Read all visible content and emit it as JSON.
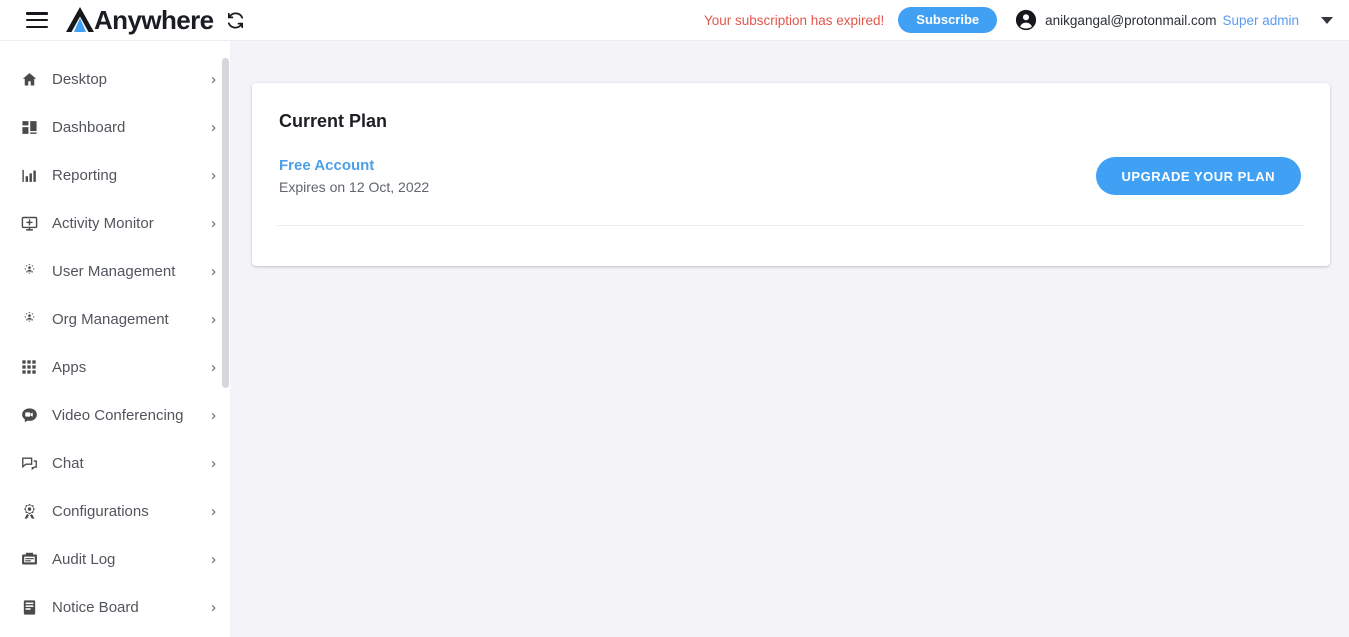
{
  "header": {
    "menu_icon": "hamburger-menu-icon",
    "logo_text": "Anywhere",
    "logo_icon": "anywhere-mountain-logo",
    "refresh_icon": "refresh-sync-icon",
    "expired_message": "Your subscription has expired!",
    "subscribe_label": "Subscribe",
    "avatar_icon": "account-circle-icon",
    "user_email": "anikgangal@protonmail.com",
    "user_role": "Super admin",
    "caret_icon": "caret-down-icon"
  },
  "sidebar": {
    "items": [
      {
        "label": "Desktop",
        "icon": "home-icon",
        "chevron": "›"
      },
      {
        "label": "Dashboard",
        "icon": "dashboard-grid-icon",
        "chevron": "›"
      },
      {
        "label": "Reporting",
        "icon": "bar-chart-icon",
        "chevron": "›"
      },
      {
        "label": "Activity Monitor",
        "icon": "monitor-activity-icon",
        "chevron": "›"
      },
      {
        "label": "User Management",
        "icon": "user-gear-icon",
        "chevron": "›"
      },
      {
        "label": "Org Management",
        "icon": "org-gear-icon",
        "chevron": "›"
      },
      {
        "label": "Apps",
        "icon": "apps-grid-icon",
        "chevron": "›"
      },
      {
        "label": "Video Conferencing",
        "icon": "video-chat-icon",
        "chevron": "›"
      },
      {
        "label": "Chat",
        "icon": "chat-bubbles-icon",
        "chevron": "›"
      },
      {
        "label": "Configurations",
        "icon": "settings-gear-icon",
        "chevron": "›"
      },
      {
        "label": "Audit Log",
        "icon": "audit-log-icon",
        "chevron": "›"
      },
      {
        "label": "Notice Board",
        "icon": "notice-board-icon",
        "chevron": "›"
      }
    ]
  },
  "main": {
    "card": {
      "title": "Current Plan",
      "plan_name": "Free Account",
      "plan_expiry": "Expires on 12 Oct, 2022",
      "upgrade_label": "UPGRADE YOUR PLAN"
    }
  },
  "colors": {
    "accent_blue": "#3fa0f4",
    "link_blue": "#5b9bf3",
    "alert_red": "#e2574c",
    "page_bg": "#f4f4f8",
    "card_bg": "#ffffff"
  }
}
